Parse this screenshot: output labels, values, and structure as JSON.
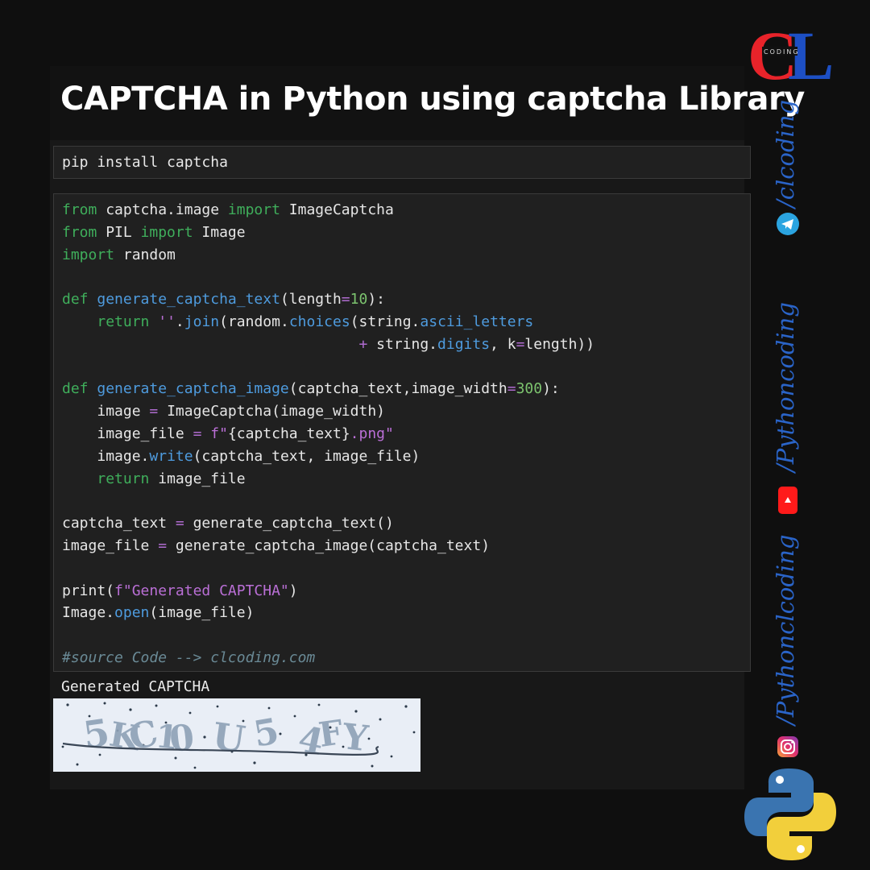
{
  "title": "CAPTCHA in Python using captcha Library",
  "cells": {
    "pip": "pip install captcha",
    "output_text": "Generated CAPTCHA"
  },
  "code": {
    "l1": {
      "a": "from",
      "b": " captcha.image ",
      "c": "import",
      "d": " ImageCaptcha"
    },
    "l2": {
      "a": "from",
      "b": " PIL ",
      "c": "import",
      "d": " Image"
    },
    "l3": {
      "a": "import",
      "b": " random"
    },
    "l5": {
      "a": "def",
      "b": " ",
      "c": "generate_captcha_text",
      "d": "(length",
      "e": "=",
      "f": "10",
      "g": "):"
    },
    "l6": {
      "ind": "    ",
      "a": "return",
      "b": " ",
      "c": "''",
      "d": ".",
      "e": "join",
      "f": "(random.",
      "g": "choices",
      "h": "(string.",
      "i": "ascii_letters"
    },
    "l7": {
      "ind": "                                  ",
      "a": "+",
      "b": " string.",
      "c": "digits",
      "d": ", k",
      "e": "=",
      "f": "length))"
    },
    "l9": {
      "a": "def",
      "b": " ",
      "c": "generate_captcha_image",
      "d": "(captcha_text,image_width",
      "e": "=",
      "f": "300",
      "g": "):"
    },
    "l10": {
      "ind": "    ",
      "a": "image ",
      "b": "=",
      "c": " ImageCaptcha(image_width)"
    },
    "l11": {
      "ind": "    ",
      "a": "image_file ",
      "b": "=",
      "c": " ",
      "d": "f\"",
      "e": "{captcha_text}",
      "f": ".png\""
    },
    "l12": {
      "ind": "    ",
      "a": "image.",
      "b": "write",
      "c": "(captcha_text, image_file)"
    },
    "l13": {
      "ind": "    ",
      "a": "return",
      "b": " image_file"
    },
    "l15": {
      "a": "captcha_text ",
      "b": "=",
      "c": " generate_captcha_text()"
    },
    "l16": {
      "a": "image_file ",
      "b": "=",
      "c": " generate_captcha_image(captcha_text)"
    },
    "l18": {
      "a": "print(",
      "b": "f\"Generated CAPTCHA\"",
      "c": ")"
    },
    "l19": {
      "a": "Image.",
      "b": "open",
      "c": "(image_file)"
    },
    "l21": {
      "a": "#source Code --> clcoding.com"
    }
  },
  "captcha_glyphs": [
    "5",
    "K",
    "C",
    "1",
    "0",
    "U",
    "5",
    "4",
    "F",
    "Y"
  ],
  "sidebar": {
    "handle_telegram": "/clcoding",
    "handle_youtube": "/Pythoncoding",
    "handle_instagram": "/Pythonclcoding",
    "logo_letters": [
      "C",
      "L"
    ],
    "logo_tagline": "CODING"
  },
  "icons": [
    "telegram-icon",
    "youtube-icon",
    "instagram-icon",
    "python-logo"
  ],
  "colors": {
    "background": "#0f0f0f",
    "keyword": "#3fae5b",
    "function": "#4e9bde",
    "string": "#ba6fd6",
    "comment": "#6a8a96",
    "handle": "#2a64c8",
    "logo_red": "#e8232a",
    "logo_blue": "#1d4fc4",
    "python_blue": "#3a74b0",
    "python_yellow": "#f2cf3b"
  }
}
